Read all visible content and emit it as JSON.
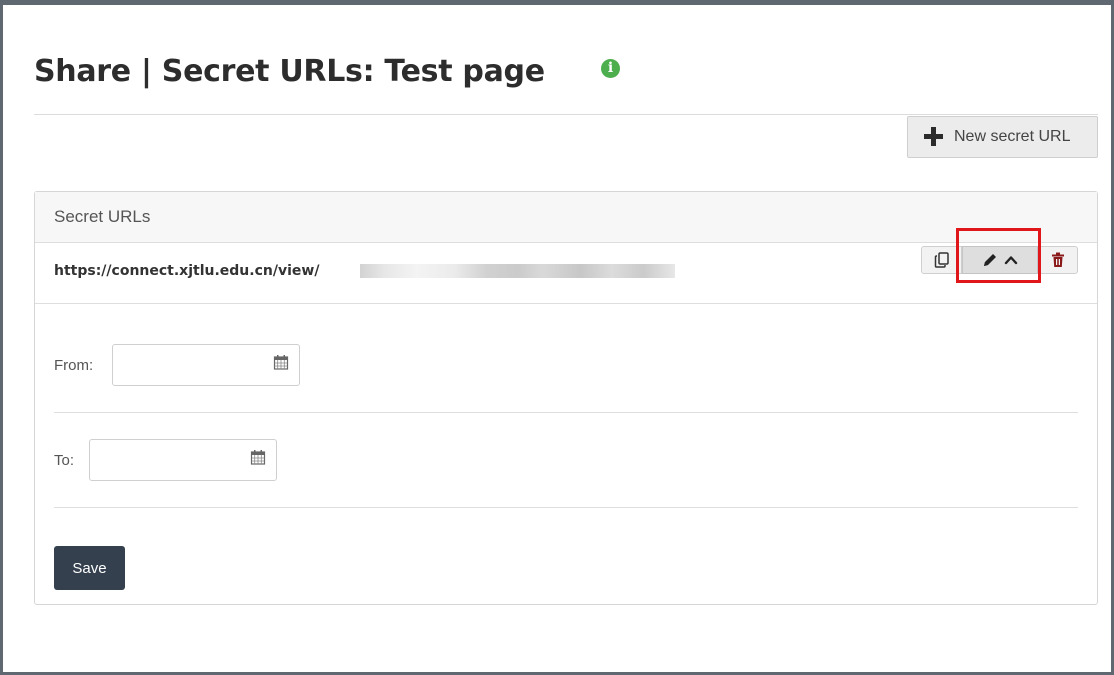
{
  "page": {
    "title": "Share | Secret URLs: Test page",
    "info_icon": "info-circle-icon",
    "colors": {
      "info": "#4cae4c",
      "save_button": "#34404e",
      "highlight_border": "#e0161a"
    }
  },
  "toolbar": {
    "new_secret_url_label": "New secret URL",
    "new_secret_url_icon": "plus-icon"
  },
  "panel": {
    "heading": "Secret URLs",
    "url": "https://connect.xjtlu.edu.cn/view/",
    "url_suffix_redacted": true,
    "actions": [
      {
        "name": "copy",
        "icon": "copy-icon"
      },
      {
        "name": "edit",
        "icon": "pencil-icon",
        "secondary_icon": "chevron-up-icon",
        "active": true
      },
      {
        "name": "delete",
        "icon": "trash-icon"
      }
    ]
  },
  "form": {
    "from_label": "From:",
    "from_value": "",
    "to_label": "To:",
    "to_value": "",
    "calendar_icon": "calendar-icon",
    "save_label": "Save"
  }
}
